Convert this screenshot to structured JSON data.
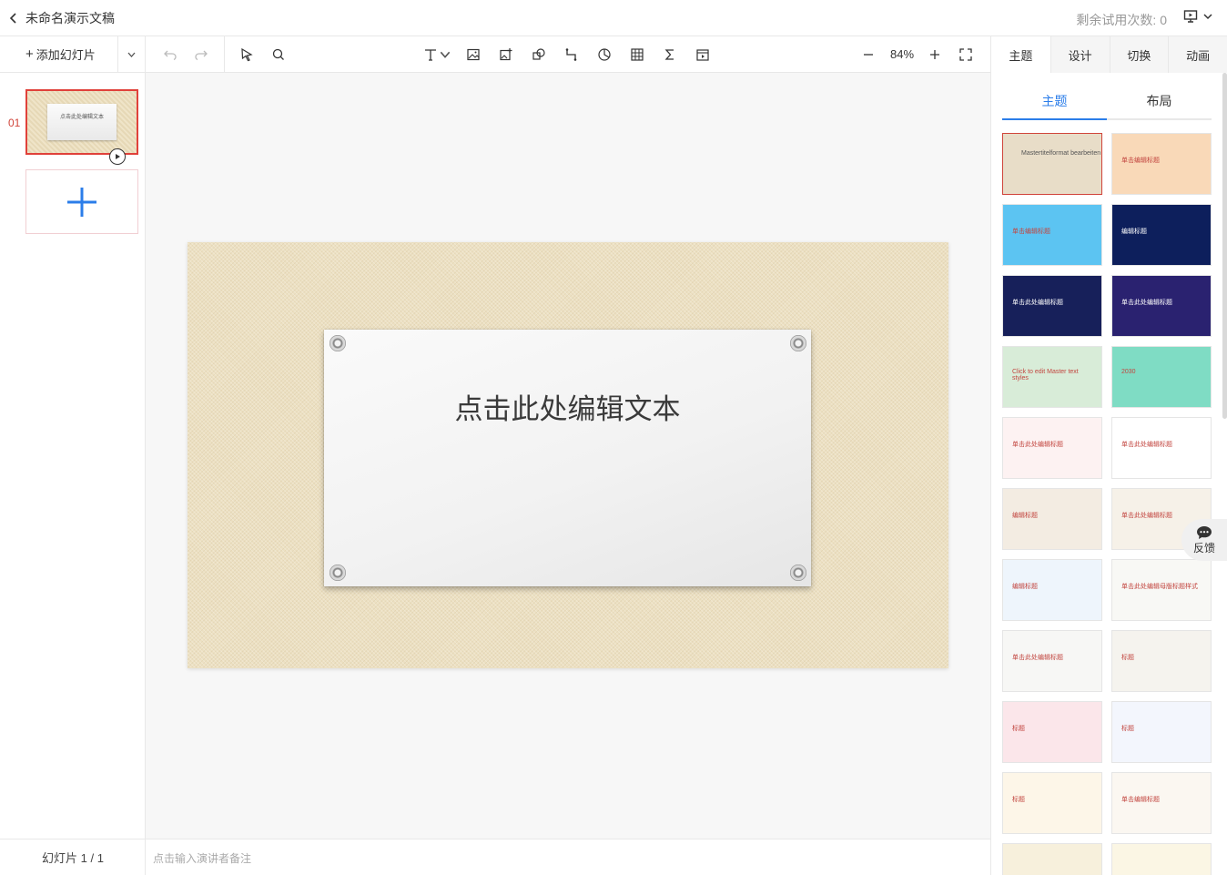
{
  "header": {
    "title": "未命名演示文稿",
    "trial_text": "剩余试用次数: 0"
  },
  "left_panel": {
    "add_slide_label": "添加幻灯片",
    "slide_number": "01",
    "thumb_text": "点击此处编辑文本",
    "slide_count": "幻灯片 1 / 1"
  },
  "toolbar": {
    "zoom": "84%"
  },
  "slide": {
    "text": "点击此处编辑文本"
  },
  "notes": {
    "placeholder": "点击输入演讲者备注"
  },
  "right_panel": {
    "tabs": [
      "主题",
      "设计",
      "切换",
      "动画"
    ],
    "subtabs": [
      "主题",
      "布局"
    ],
    "themes": [
      {
        "label": "Mastertitelformat bearbeiten",
        "bg": "#e8ddc8"
      },
      {
        "label": "单击编辑标题",
        "bg": "#f9d9b8"
      },
      {
        "label": "单击编辑标题",
        "bg": "#5cc4f2"
      },
      {
        "label": "编辑标题",
        "bg": "#0d1f5c"
      },
      {
        "label": "单击此处编辑标题",
        "bg": "#17205a"
      },
      {
        "label": "单击此处编辑标题",
        "bg": "#2a2270"
      },
      {
        "label": "Click to edit Master text styles",
        "bg": "#d8ecd8"
      },
      {
        "label": "2030",
        "bg": "#7fdcc4"
      },
      {
        "label": "单击此处编辑标题",
        "bg": "#fdf2f2"
      },
      {
        "label": "单击此处编辑标题",
        "bg": "#ffffff"
      },
      {
        "label": "编辑标题",
        "bg": "#f3ece2"
      },
      {
        "label": "单击此处编辑标题",
        "bg": "#f6f1e8"
      },
      {
        "label": "编辑标题",
        "bg": "#eef5fc"
      },
      {
        "label": "单击此处编辑母版标题样式",
        "bg": "#f8f8f5"
      },
      {
        "label": "单击此处编辑标题",
        "bg": "#f7f7f5"
      },
      {
        "label": "标题",
        "bg": "#f5f3ee"
      },
      {
        "label": "标题",
        "bg": "#fbe6ea"
      },
      {
        "label": "标题",
        "bg": "#f3f6fd"
      },
      {
        "label": "标题",
        "bg": "#fdf6e8"
      },
      {
        "label": "单击编辑标题",
        "bg": "#fbf7f1"
      },
      {
        "label": "",
        "bg": "#f7f0dc"
      },
      {
        "label": "",
        "bg": "#fbf6e4"
      }
    ],
    "feedback_label": "反馈"
  }
}
